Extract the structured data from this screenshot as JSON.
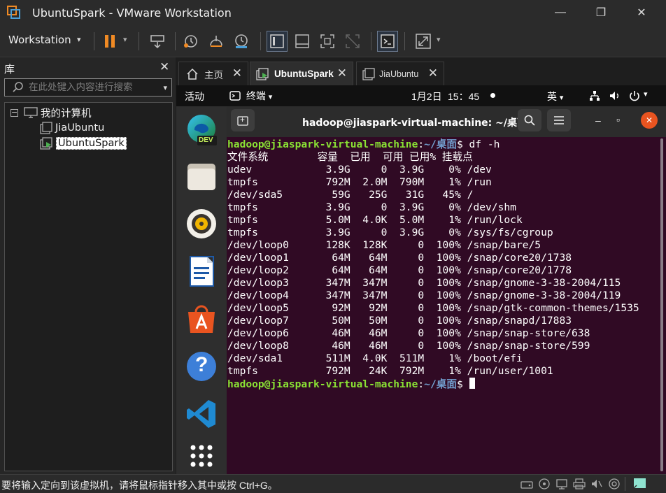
{
  "window": {
    "title": "UbuntuSpark - VMware Workstation",
    "minimize": "—",
    "maximize": "❐",
    "close": "✕"
  },
  "toolbar": {
    "menu_label": "Workstation",
    "menu_caret": "▾"
  },
  "library": {
    "heading": "库",
    "close": "✕",
    "search_placeholder": "在此处键入内容进行搜索",
    "search_caret": "▾",
    "tree": {
      "root_toggle": "−",
      "root_label": "我的计算机",
      "vms": [
        "JiaUbuntu",
        "UbuntuSpark"
      ],
      "selected_vm": "UbuntuSpark"
    }
  },
  "tabs": [
    {
      "label": "主页",
      "close": "✕",
      "icon": "home-icon"
    },
    {
      "label": "UbuntuSpark",
      "close": "✕",
      "icon": "vm-running-icon",
      "active": true
    },
    {
      "label": "JiaUbuntu",
      "close": "✕",
      "icon": "vm-icon"
    }
  ],
  "ubuntu_topbar": {
    "activities": "活动",
    "app_menu": "终端",
    "app_caret": "▾",
    "date": "1月2日",
    "time": "15：45",
    "input_method": "英",
    "input_caret": "▾"
  },
  "dock": {
    "apps": [
      "edge-dev-icon",
      "files-icon",
      "rhythmbox-icon",
      "writer-icon",
      "software-center-icon",
      "help-icon",
      "vscode-icon",
      "show-apps-icon"
    ],
    "dev_badge": "DEV",
    "help_glyph": "?"
  },
  "terminal": {
    "title": "hadoop@jiaspark-virtual-machine: ~/桌面",
    "new_tab": "+",
    "minimize": "–",
    "maximize": "▫",
    "close": "✕",
    "prompt_user": "hadoop@jiaspark-virtual-machine",
    "prompt_colon": ":",
    "prompt_path": "~/桌面",
    "prompt_dollar": "$ ",
    "command": "df -h",
    "output_lines": [
      "文件系统        容量  已用  可用 已用% 挂载点",
      "udev            3.9G     0  3.9G    0% /dev",
      "tmpfs           792M  2.0M  790M    1% /run",
      "/dev/sda5        59G   25G   31G   45% /",
      "tmpfs           3.9G     0  3.9G    0% /dev/shm",
      "tmpfs           5.0M  4.0K  5.0M    1% /run/lock",
      "tmpfs           3.9G     0  3.9G    0% /sys/fs/cgroup",
      "/dev/loop0      128K  128K     0  100% /snap/bare/5",
      "/dev/loop1       64M   64M     0  100% /snap/core20/1738",
      "/dev/loop2       64M   64M     0  100% /snap/core20/1778",
      "/dev/loop3      347M  347M     0  100% /snap/gnome-3-38-2004/115",
      "/dev/loop4      347M  347M     0  100% /snap/gnome-3-38-2004/119",
      "/dev/loop5       92M   92M     0  100% /snap/gtk-common-themes/1535",
      "/dev/loop7       50M   50M     0  100% /snap/snapd/17883",
      "/dev/loop6       46M   46M     0  100% /snap/snap-store/638",
      "/dev/loop8       46M   46M     0  100% /snap/snap-store/599",
      "/dev/sda1       511M  4.0K  511M    1% /boot/efi",
      "tmpfs           792M   24K  792M    1% /run/user/1001"
    ]
  },
  "statusbar": {
    "message": "要将输入定向到该虚拟机，请将鼠标指针移入其中或按 Ctrl+G。",
    "icons": [
      "hard-disk-icon",
      "cd-icon",
      "network-icon",
      "usb-icon",
      "printer-icon",
      "sound-icon",
      "display-icon",
      "message-icon"
    ]
  },
  "colors": {
    "terminal_bg": "#300a24",
    "prompt_user": "#8ae234",
    "prompt_path": "#729fcf",
    "pause_orange": "#f08a24",
    "close_red": "#e95420"
  }
}
